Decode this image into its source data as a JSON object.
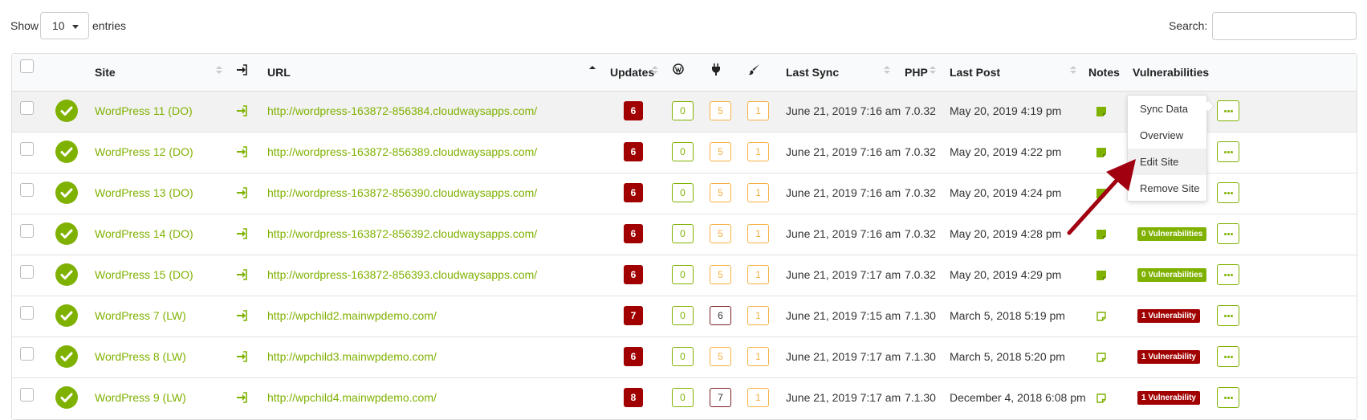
{
  "controls": {
    "show_label": "Show",
    "page_length": "10",
    "entries_label": "entries",
    "search_label": "Search:",
    "search_value": ""
  },
  "columns": {
    "site": "Site",
    "url": "URL",
    "updates": "Updates",
    "last_sync": "Last Sync",
    "php": "PHP",
    "last_post": "Last Post",
    "notes": "Notes",
    "vulnerabilities": "Vulnerabilities"
  },
  "column_icons": {
    "login": "sign-in-icon",
    "wordpress": "wordpress-icon",
    "plugins": "plug-icon",
    "themes": "paint-brush-icon"
  },
  "rows": [
    {
      "site": "WordPress 11 (DO)",
      "url": "http://wordpress-163872-856384.cloudwaysapps.com/",
      "updates": "6",
      "wp": "0",
      "plugins": "5",
      "themes": "1",
      "last_sync": "June 21, 2019 7:16 am",
      "php": "7.0.32",
      "last_post": "May 20, 2019 4:19 pm",
      "note": "filled",
      "vuln": "",
      "vuln_type": "",
      "plugins_style": "light"
    },
    {
      "site": "WordPress 12 (DO)",
      "url": "http://wordpress-163872-856389.cloudwaysapps.com/",
      "updates": "6",
      "wp": "0",
      "plugins": "5",
      "themes": "1",
      "last_sync": "June 21, 2019 7:16 am",
      "php": "7.0.32",
      "last_post": "May 20, 2019 4:22 pm",
      "note": "filled",
      "vuln": "",
      "vuln_type": "",
      "plugins_style": "light"
    },
    {
      "site": "WordPress 13 (DO)",
      "url": "http://wordpress-163872-856390.cloudwaysapps.com/",
      "updates": "6",
      "wp": "0",
      "plugins": "5",
      "themes": "1",
      "last_sync": "June 21, 2019 7:16 am",
      "php": "7.0.32",
      "last_post": "May 20, 2019 4:24 pm",
      "note": "filled",
      "vuln": "",
      "vuln_type": "",
      "plugins_style": "light"
    },
    {
      "site": "WordPress 14 (DO)",
      "url": "http://wordpress-163872-856392.cloudwaysapps.com/",
      "updates": "6",
      "wp": "0",
      "plugins": "5",
      "themes": "1",
      "last_sync": "June 21, 2019 7:16 am",
      "php": "7.0.32",
      "last_post": "May 20, 2019 4:28 pm",
      "note": "filled",
      "vuln": "0 Vulnerabilities",
      "vuln_type": "ok",
      "plugins_style": "light"
    },
    {
      "site": "WordPress 15 (DO)",
      "url": "http://wordpress-163872-856393.cloudwaysapps.com/",
      "updates": "6",
      "wp": "0",
      "plugins": "5",
      "themes": "1",
      "last_sync": "June 21, 2019 7:17 am",
      "php": "7.0.32",
      "last_post": "May 20, 2019 4:29 pm",
      "note": "filled",
      "vuln": "0 Vulnerabilities",
      "vuln_type": "ok",
      "plugins_style": "light"
    },
    {
      "site": "WordPress 7 (LW)",
      "url": "http://wpchild2.mainwpdemo.com/",
      "updates": "7",
      "wp": "0",
      "plugins": "6",
      "themes": "1",
      "last_sync": "June 21, 2019 7:15 am",
      "php": "7.1.30",
      "last_post": "March 5, 2018 5:19 pm",
      "note": "outline",
      "vuln": "1 Vulnerability",
      "vuln_type": "bad",
      "plugins_style": "dark"
    },
    {
      "site": "WordPress 8 (LW)",
      "url": "http://wpchild3.mainwpdemo.com/",
      "updates": "6",
      "wp": "0",
      "plugins": "5",
      "themes": "1",
      "last_sync": "June 21, 2019 7:17 am",
      "php": "7.1.30",
      "last_post": "March 5, 2018 5:20 pm",
      "note": "outline",
      "vuln": "1 Vulnerability",
      "vuln_type": "bad",
      "plugins_style": "light"
    },
    {
      "site": "WordPress 9 (LW)",
      "url": "http://wpchild4.mainwpdemo.com/",
      "updates": "8",
      "wp": "0",
      "plugins": "7",
      "themes": "1",
      "last_sync": "June 21, 2019 7:17 am",
      "php": "7.1.30",
      "last_post": "December 4, 2018 6:08 pm",
      "note": "outline",
      "vuln": "1 Vulnerability",
      "vuln_type": "bad",
      "plugins_style": "dark"
    }
  ],
  "dropdown_menu": {
    "items": [
      "Sync Data",
      "Overview",
      "Edit Site",
      "Remove Site"
    ],
    "active_index": 2
  },
  "colors": {
    "accent_green": "#7fb100",
    "danger_red": "#a00000",
    "warning_orange": "#f5b041",
    "annotation_arrow": "#a00010"
  }
}
